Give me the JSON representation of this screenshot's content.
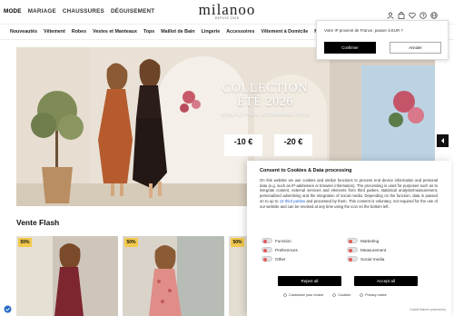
{
  "topnav": {
    "items": [
      "MODE",
      "MARIAGE",
      "CHAUSSURES",
      "DÉGUISEMENT"
    ]
  },
  "logo": {
    "text": "milanoo",
    "sub": "DEPUIS 2008"
  },
  "icons": [
    "user-icon",
    "bag-icon",
    "heart-icon",
    "help-icon",
    "globe-icon"
  ],
  "categories": [
    "Nouveautés",
    "Vêtement",
    "Robes",
    "Vestes et Manteaux",
    "Tops",
    "Maillot de Bain",
    "Lingerie",
    "Accessoires",
    "Vêtement à Domicile",
    "M"
  ],
  "hero": {
    "line1": "COLLECTION",
    "line2": "ÉTÉ 2026",
    "line3": "ACHETEZ PLUS, ÉCONOMISEZ PLUS",
    "price1": "-10 €",
    "price2": "-20 €"
  },
  "flash": {
    "title": "Vente Flash",
    "badges": [
      "50%",
      "50%",
      "50%"
    ]
  },
  "ip_popup": {
    "text": "Votre IP provient de France, passer à EUR ?",
    "confirm": "Confirmer",
    "cancel": "Annuler"
  },
  "cookie": {
    "title": "Consent to Cookies & Data processing",
    "body_before": "On this website we use cookies and similar functions to process end device information and personal data (e.g. such as IP-addresses or browser information). The processing is used for purposes such as to integrate content, external services and elements from third parties, statistical analysis/measurement, personalized advertising and the integration of social media. Depending on the function, data is passed on to up to ",
    "body_link": "13 third parties",
    "body_after": " and processed by them. This consent is voluntary, not required for the use of our website and can be revoked at any time using the icon on the bottom left.",
    "toggles": [
      "Function",
      "Marketing",
      "Preferences",
      "Measurement",
      "Other",
      "Social media"
    ],
    "reject": "Reject all",
    "accept": "Accept all",
    "links": [
      "Customize your choice",
      "Cookies",
      "Privacy notice"
    ],
    "powered": "Cookie Banner powered by"
  }
}
